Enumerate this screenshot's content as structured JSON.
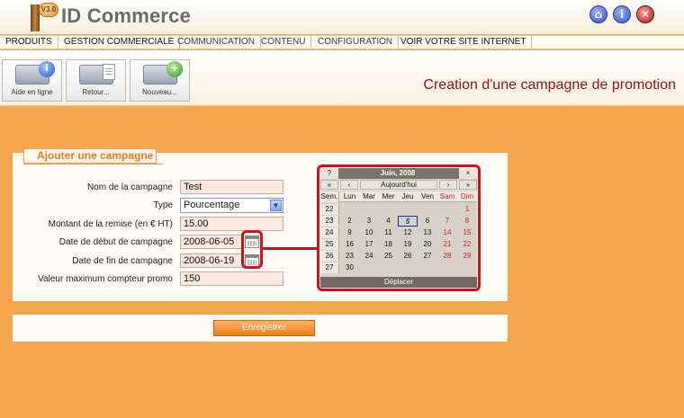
{
  "app": {
    "title": "ID Commerce",
    "version_badge": "V3.0"
  },
  "header_icons": [
    "home-icon",
    "info-icon",
    "close-icon"
  ],
  "menu": [
    "PRODUITS",
    "GESTION COMMERCIALE",
    "COMMUNICATION",
    "CONTENU",
    "CONFIGURATION",
    "VOIR VOTRE SITE INTERNET"
  ],
  "toolbar": {
    "help": "Aide en ligne",
    "back": "Retour...",
    "new": "Nouveau..."
  },
  "page_title": "Creation d'une campagne de promotion",
  "form": {
    "legend": "Ajouter une campagne",
    "name_label": "Nom de la campagne",
    "name_value": "Test",
    "type_label": "Type",
    "type_value": "Pourcentage",
    "amount_label": "Montant de la remise (en € HT)",
    "amount_value": "15.00",
    "start_label": "Date de début de campagne",
    "start_value": "2008-06-05",
    "end_label": "Date de fin de campagne",
    "end_value": "2008-06-19",
    "max_label": "Valeur maximum compteur promo",
    "max_value": "150",
    "save_label": "Enregistrer"
  },
  "calendar": {
    "help": "?",
    "title": "Juin, 2008",
    "close": "×",
    "prev_year": "«",
    "prev_month": "‹",
    "today_label": "Aujourd'hui",
    "next_month": "›",
    "next_year": "»",
    "week_header": "Sem.",
    "days": [
      "Lun",
      "Mar",
      "Mer",
      "Jeu",
      "Ven",
      "Sam",
      "Dim"
    ],
    "weeks": [
      {
        "wk": "22",
        "days": [
          "",
          "",
          "",
          "",
          "",
          "",
          "1"
        ]
      },
      {
        "wk": "23",
        "days": [
          "2",
          "3",
          "4",
          "5",
          "6",
          "7",
          "8"
        ]
      },
      {
        "wk": "24",
        "days": [
          "9",
          "10",
          "11",
          "12",
          "13",
          "14",
          "15"
        ]
      },
      {
        "wk": "25",
        "days": [
          "16",
          "17",
          "18",
          "19",
          "20",
          "21",
          "22"
        ]
      },
      {
        "wk": "26",
        "days": [
          "23",
          "24",
          "25",
          "26",
          "27",
          "28",
          "29"
        ]
      },
      {
        "wk": "27",
        "days": [
          "30",
          "",
          "",
          "",
          "",
          "",
          ""
        ]
      }
    ],
    "highlighted_day": "5",
    "footer": "Déplacer"
  },
  "colors": {
    "accent_orange": "#f5a64e",
    "title_red": "#8b1414",
    "highlight_red": "#d0101c"
  }
}
